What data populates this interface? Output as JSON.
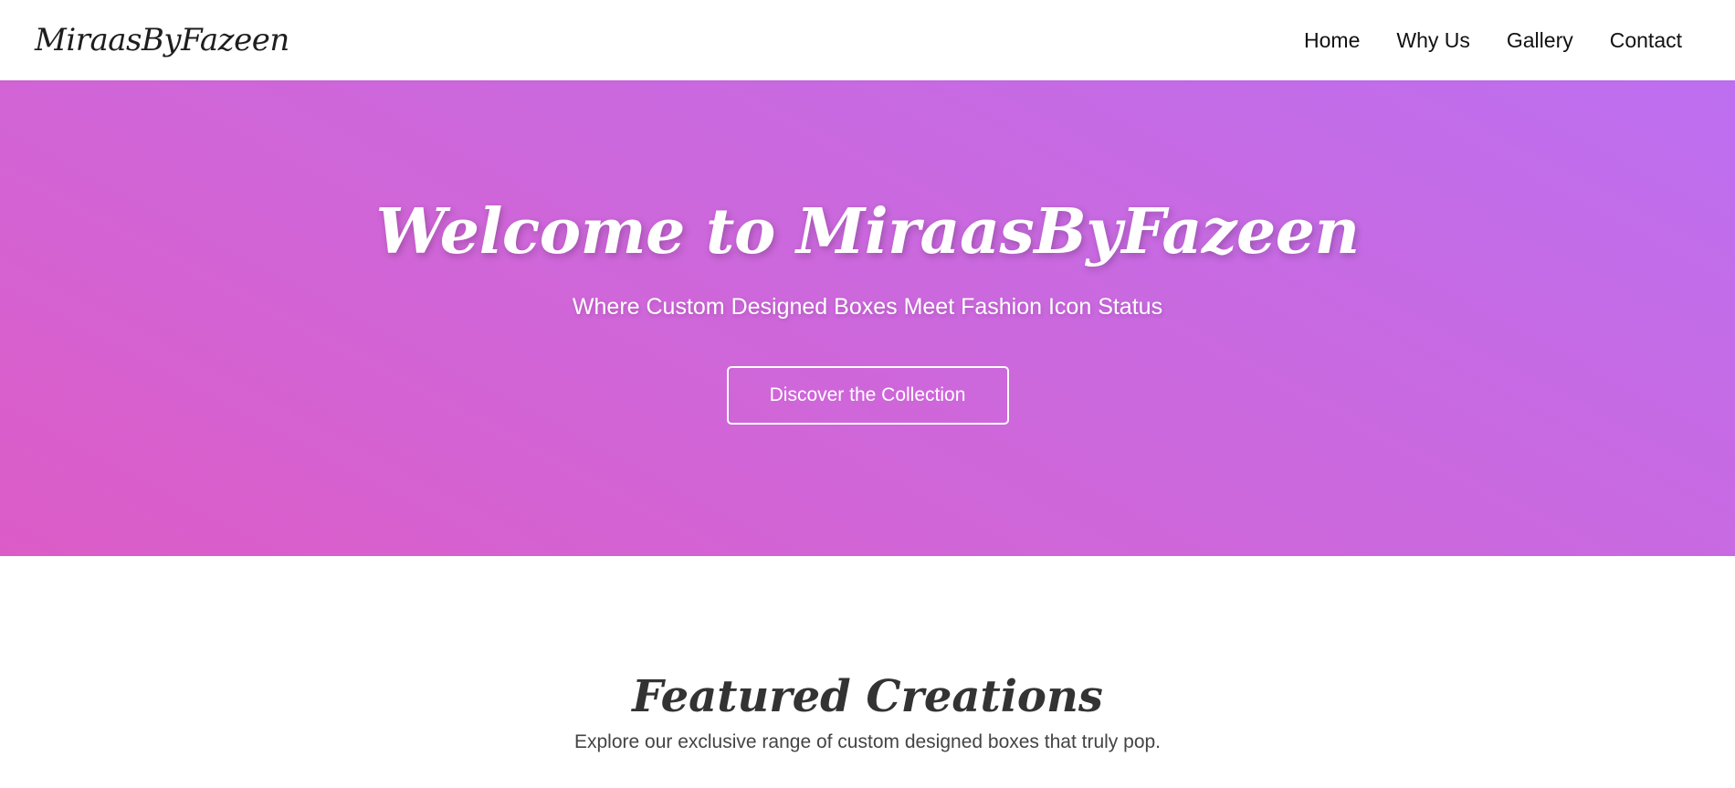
{
  "navbar": {
    "logo": "MiraasByFazeen",
    "links": [
      {
        "label": "Home"
      },
      {
        "label": "Why Us"
      },
      {
        "label": "Gallery"
      },
      {
        "label": "Contact"
      }
    ]
  },
  "hero": {
    "title": "Welcome to MiraasByFazeen",
    "subtitle": "Where Custom Designed Boxes Meet Fashion Icon Status",
    "cta_label": "Discover the Collection",
    "gradient_start": "#dc5cc7",
    "gradient_end": "#bd6ff0"
  },
  "featured": {
    "title": "Featured Creations",
    "subtitle": "Explore our exclusive range of custom designed boxes that truly pop."
  }
}
